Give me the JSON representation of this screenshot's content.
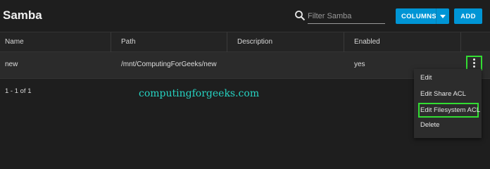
{
  "header": {
    "title": "Samba",
    "search": {
      "placeholder": "Filter Samba",
      "value": ""
    },
    "columns_label": "COLUMNS",
    "add_label": "ADD"
  },
  "table": {
    "columns": [
      "Name",
      "Path",
      "Description",
      "Enabled"
    ],
    "rows": [
      {
        "name": "new",
        "path": "/mnt/ComputingForGeeks/new",
        "description": "",
        "enabled": "yes"
      }
    ],
    "pager": "1 - 1 of 1"
  },
  "watermark": "computingforgeeks.com",
  "actions_menu": {
    "items": [
      "Edit",
      "Edit Share ACL",
      "Edit Filesystem ACL",
      "Delete"
    ],
    "highlighted": "Edit Filesystem ACL"
  },
  "icons": {
    "search": "search-icon",
    "more": "more-vert-icon",
    "dropdown": "caret-down-icon"
  },
  "colors": {
    "accent": "#0095d5",
    "highlight": "#33dd33",
    "watermark": "#26d3c2"
  }
}
